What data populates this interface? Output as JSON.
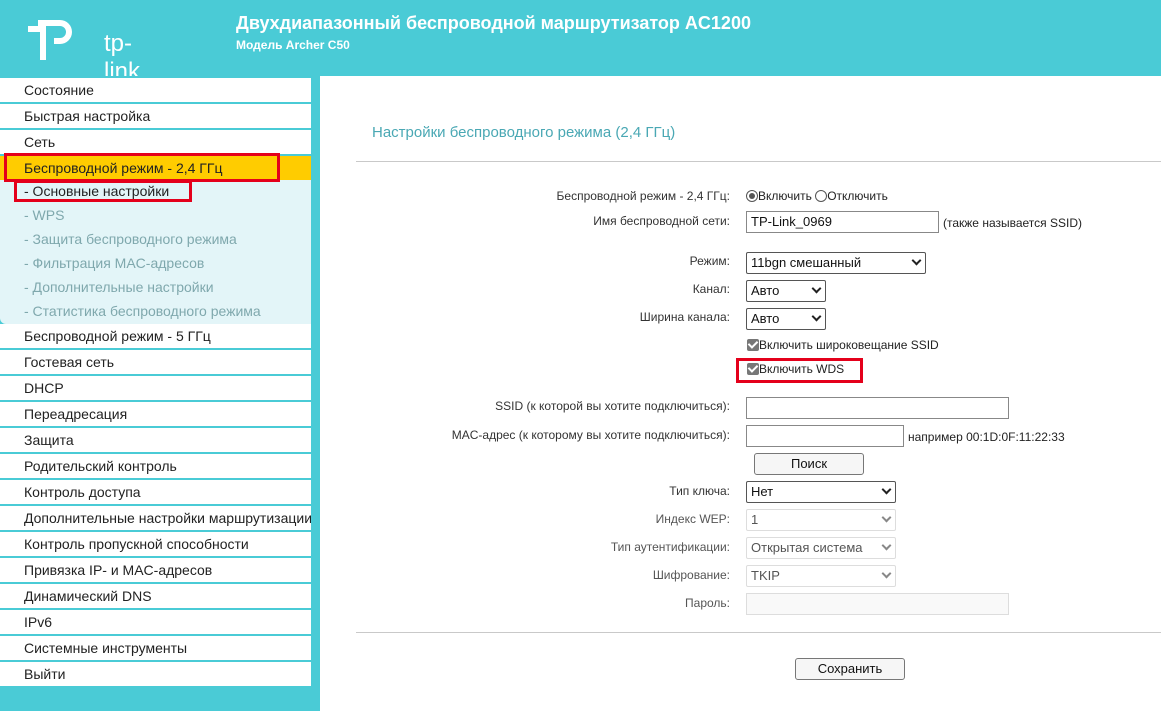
{
  "header": {
    "logo_text": "tp-link",
    "title": "Двухдиапазонный беспроводной маршрутизатор AC1200",
    "subtitle": "Модель Archer C50"
  },
  "sidebar": {
    "items": [
      {
        "label": "Состояние"
      },
      {
        "label": "Быстрая настройка"
      },
      {
        "label": "Сеть"
      },
      {
        "label": "Беспроводной режим - 2,4 ГГц",
        "active": true
      },
      {
        "label": "Беспроводной режим - 5 ГГц"
      },
      {
        "label": "Гостевая сеть"
      },
      {
        "label": "DHCP"
      },
      {
        "label": "Переадресация"
      },
      {
        "label": "Защита"
      },
      {
        "label": "Родительский контроль"
      },
      {
        "label": "Контроль доступа"
      },
      {
        "label": "Дополнительные настройки маршрутизации"
      },
      {
        "label": "Контроль пропускной способности"
      },
      {
        "label": "Привязка IP- и MAC-адресов"
      },
      {
        "label": "Динамический DNS"
      },
      {
        "label": "IPv6"
      },
      {
        "label": "Системные инструменты"
      },
      {
        "label": "Выйти"
      }
    ],
    "subitems": [
      {
        "label": "- Основные настройки",
        "current": true
      },
      {
        "label": "- WPS"
      },
      {
        "label": "- Защита беспроводного режима"
      },
      {
        "label": "- Фильтрация MAC-адресов"
      },
      {
        "label": "- Дополнительные настройки"
      },
      {
        "label": "- Статистика беспроводного режима"
      }
    ]
  },
  "main": {
    "section_title": "Настройки беспроводного режима (2,4 ГГц)",
    "wireless_mode": {
      "label": "Беспроводной режим - 2,4 ГГц:",
      "enable": "Включить",
      "disable": "Отключить",
      "selected": "enable"
    },
    "ssid": {
      "label": "Имя беспроводной сети:",
      "value": "TP-Link_0969",
      "hint": "(также называется SSID)"
    },
    "mode": {
      "label": "Режим:",
      "value": "11bgn смешанный"
    },
    "channel": {
      "label": "Канал:",
      "value": "Авто"
    },
    "channel_width": {
      "label": "Ширина канала:",
      "value": "Авто"
    },
    "ssid_broadcast": {
      "label": "Включить широковещание SSID",
      "checked": true
    },
    "wds": {
      "label": "Включить WDS",
      "checked": true
    },
    "wds_ssid": {
      "label": "SSID (к которой вы хотите подключиться):",
      "value": ""
    },
    "wds_mac": {
      "label": "MAC-адрес (к которому вы хотите подключиться):",
      "value": "",
      "hint": "например 00:1D:0F:11:22:33"
    },
    "search_button": "Поиск",
    "key_type": {
      "label": "Тип ключа:",
      "value": "Нет"
    },
    "wep_index": {
      "label": "Индекс WEP:",
      "value": "1"
    },
    "auth_type": {
      "label": "Тип аутентификации:",
      "value": "Открытая система"
    },
    "encryption": {
      "label": "Шифрование:",
      "value": "TKIP"
    },
    "password": {
      "label": "Пароль:",
      "value": ""
    },
    "save_button": "Сохранить"
  },
  "colors": {
    "header": "#4acbd6",
    "active_nav": "#ffcc00",
    "highlight": "#e4001b",
    "title_text": "#4aa8b4"
  }
}
